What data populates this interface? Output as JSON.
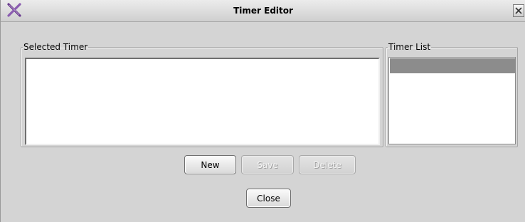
{
  "window": {
    "title": "Timer Editor",
    "logo_icon": "app-x-logo-icon",
    "close_icon": "close-icon"
  },
  "selected_timer": {
    "legend": "Selected Timer",
    "content": ""
  },
  "timer_list": {
    "legend": "Timer List",
    "items": [
      ""
    ]
  },
  "buttons": {
    "new_label": "New",
    "save_label": "Save",
    "delete_label": "Delete",
    "close_label": "Close"
  },
  "colors": {
    "background": "#d4d4d4",
    "selection_highlight": "#8c8c8c"
  }
}
